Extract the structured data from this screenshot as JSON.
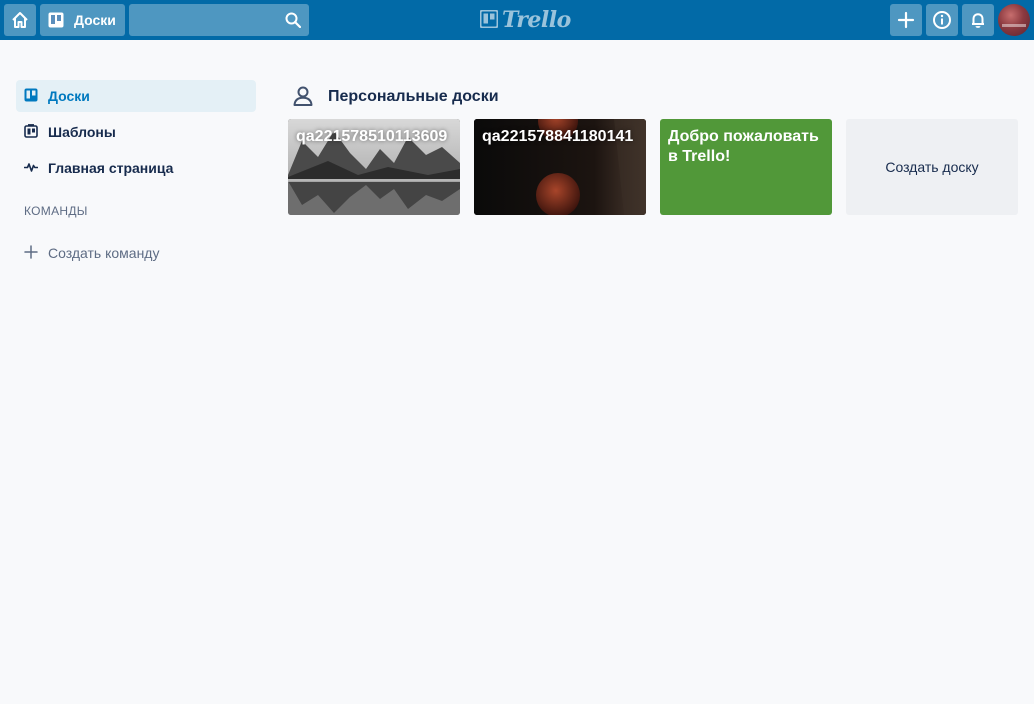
{
  "header": {
    "boards_label": "Доски",
    "search": {
      "value": "",
      "placeholder": ""
    },
    "logo_text": "Trello"
  },
  "sidebar": {
    "items": [
      {
        "label": "Доски",
        "icon": "board-icon",
        "active": true
      },
      {
        "label": "Шаблоны",
        "icon": "template-icon",
        "active": false
      },
      {
        "label": "Главная страница",
        "icon": "activity-icon",
        "active": false
      }
    ],
    "teams_title": "КОМАНДЫ",
    "create_team_label": "Создать команду"
  },
  "main": {
    "section_title": "Персональные доски",
    "boards": [
      {
        "name": "qa221578510113609",
        "background": "mountain-lake-photo"
      },
      {
        "name": "qa221578841180141",
        "background": "dark-moons-photo"
      },
      {
        "name": "Добро пожаловать в Trello!",
        "background": "#519839"
      }
    ],
    "create_board_label": "Создать доску"
  },
  "colors": {
    "header": "#026aa7",
    "accent": "#0079bf",
    "page_bg": "#f8f9fb",
    "green_board": "#519839"
  }
}
